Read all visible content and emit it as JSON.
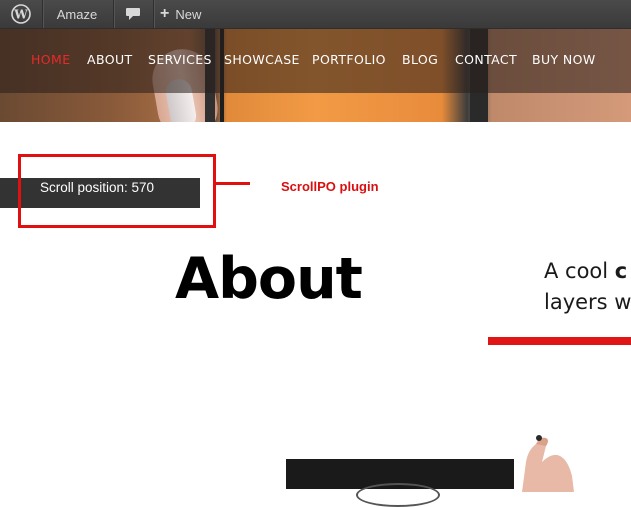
{
  "admin_bar": {
    "site_name": "Amaze",
    "new_label": "New",
    "icons": {
      "wp": "wordpress-icon",
      "comments": "comment-bubble-icon",
      "new": "plus-icon"
    }
  },
  "nav": {
    "items": [
      {
        "label": "HOME",
        "active": true
      },
      {
        "label": "ABOUT",
        "active": false
      },
      {
        "label": "SERVICES",
        "active": false
      },
      {
        "label": "SHOWCASE",
        "active": false
      },
      {
        "label": "PORTFOLIO",
        "active": false
      },
      {
        "label": "BLOG",
        "active": false
      },
      {
        "label": "CONTACT",
        "active": false
      },
      {
        "label": "BUY NOW",
        "active": false
      }
    ],
    "active_color": "#e82a2a"
  },
  "scroll_widget": {
    "text": "Scroll position: 570"
  },
  "annotation": {
    "label": "ScrollPO plugin",
    "color": "#e01010"
  },
  "about": {
    "title": "About",
    "tagline_line1_prefix": "A cool ",
    "tagline_line1_bold": "c",
    "tagline_line2": "layers w"
  },
  "colors": {
    "accent": "#e01616",
    "admin_bar": "#464646"
  }
}
